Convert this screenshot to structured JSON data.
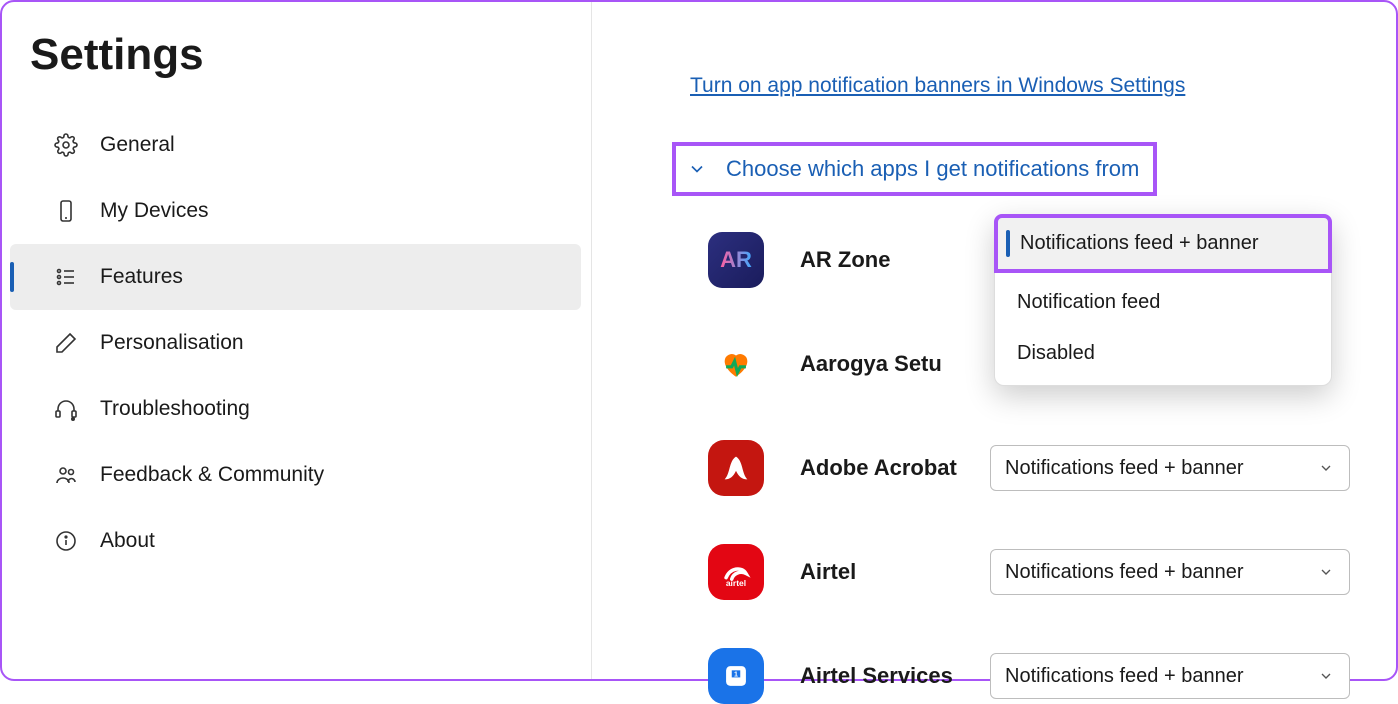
{
  "page_title": "Settings",
  "sidebar": {
    "items": [
      {
        "label": "General"
      },
      {
        "label": "My Devices"
      },
      {
        "label": "Features"
      },
      {
        "label": "Personalisation"
      },
      {
        "label": "Troubleshooting"
      },
      {
        "label": "Feedback & Community"
      },
      {
        "label": "About"
      }
    ]
  },
  "content": {
    "link": "Turn on app notification banners in Windows Settings",
    "section_title": "Choose which apps I get notifications from",
    "apps": [
      {
        "name": "AR Zone",
        "value": "Notifications feed + banner",
        "initials": "AR"
      },
      {
        "name": "Aarogya Setu",
        "value": "Notifications feed + banner"
      },
      {
        "name": "Adobe Acrobat",
        "value": "Notifications feed + banner"
      },
      {
        "name": "Airtel",
        "value": "Notifications feed + banner"
      },
      {
        "name": "Airtel Services",
        "value": "Notifications feed + banner"
      }
    ],
    "popup_options": [
      "Notifications feed + banner",
      "Notification feed",
      "Disabled"
    ]
  }
}
